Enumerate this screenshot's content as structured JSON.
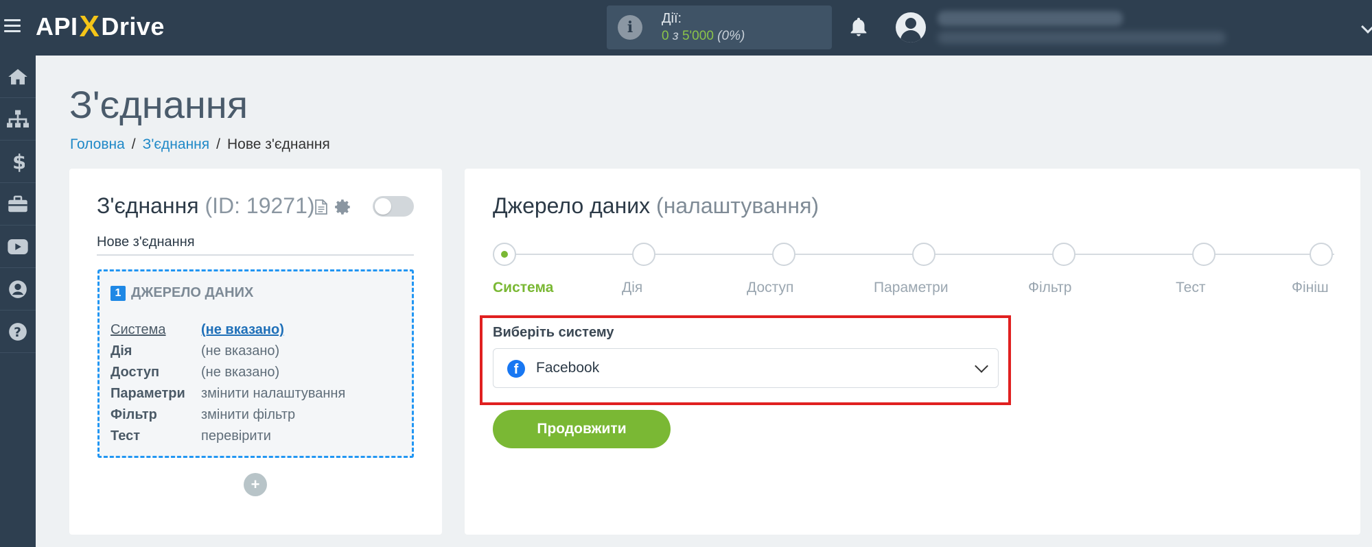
{
  "topbar": {
    "logo": {
      "part1": "API",
      "x": "X",
      "part2": "Drive"
    },
    "actions": {
      "label": "Дії:",
      "used": "0",
      "of": "з",
      "limit": "5'000",
      "percent": "(0%)"
    }
  },
  "sidebar": {
    "items": [
      {
        "icon": "home-icon"
      },
      {
        "icon": "sitemap-icon"
      },
      {
        "icon": "dollar-icon"
      },
      {
        "icon": "briefcase-icon"
      },
      {
        "icon": "youtube-icon"
      },
      {
        "icon": "user-icon"
      },
      {
        "icon": "help-icon"
      }
    ]
  },
  "page": {
    "title": "З'єднання",
    "breadcrumb": [
      "Головна",
      "З'єднання",
      "Нове з'єднання"
    ]
  },
  "connection": {
    "title": "З'єднання",
    "id_text": "(ID: 19271)",
    "name": "Нове з'єднання",
    "source": {
      "number": "1",
      "title": "ДЖЕРЕЛО ДАНИХ",
      "rows": [
        {
          "key": "Система",
          "value": "(не вказано)"
        },
        {
          "key": "Дія",
          "value": "(не вказано)"
        },
        {
          "key": "Доступ",
          "value": "(не вказано)"
        },
        {
          "key": "Параметри",
          "value": "змінити налаштування"
        },
        {
          "key": "Фільтр",
          "value": "змінити фільтр"
        },
        {
          "key": "Тест",
          "value": "перевірити"
        }
      ]
    },
    "add_label": "+"
  },
  "settings": {
    "title": "Джерело даних",
    "subtitle": "(налаштування)",
    "steps": [
      "Система",
      "Дія",
      "Доступ",
      "Параметри",
      "Фільтр",
      "Тест",
      "Фініш"
    ],
    "active_step": 0,
    "select_label": "Виберіть систему",
    "selected_system": "Facebook",
    "continue_label": "Продовжити"
  },
  "colors": {
    "topbar": "#2e3f50",
    "accent_green": "#7ab834",
    "link_blue": "#1e88c7",
    "highlight_red": "#e02020",
    "facebook_blue": "#1877f2"
  }
}
